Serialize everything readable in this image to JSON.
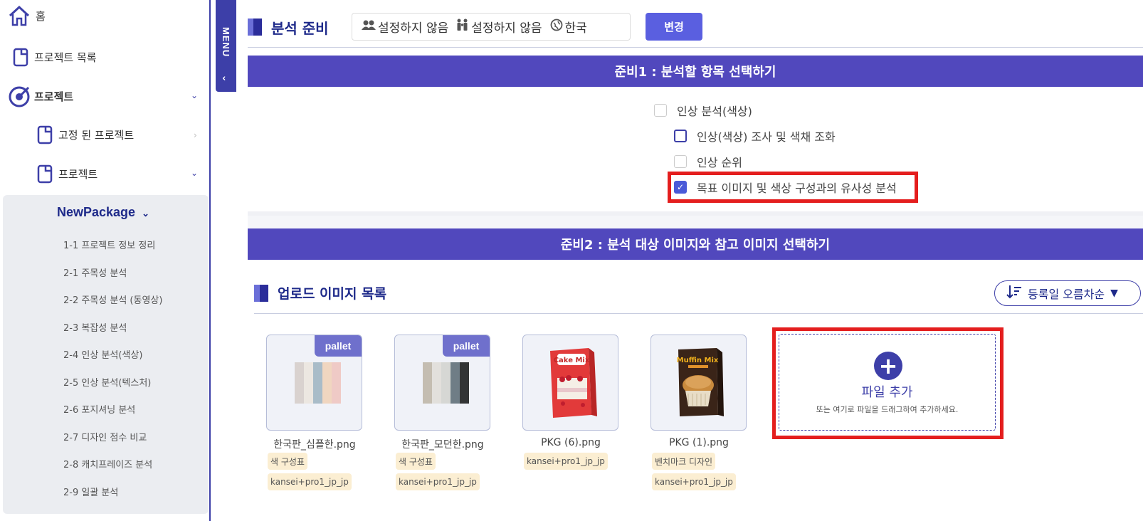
{
  "sidebar": {
    "home": "홈",
    "project_list": "프로젝트 목록",
    "project": "프로젝트",
    "pinned_project": "고정 된 프로젝트",
    "project_sub": "프로젝트",
    "package_name": "NewPackage",
    "package_items": [
      "1-1 프로젝트 정보 정리",
      "2-1 주목성 분석",
      "2-2 주목성 분석 (동영상)",
      "2-3 복잡성 분석",
      "2-4 인상 분석(색상)",
      "2-5 인상 분석(텍스처)",
      "2-6 포지셔닝 분석",
      "2-7 디자인 점수 비교",
      "2-8 캐치프레이즈 분석",
      "2-9 일괄 분석"
    ]
  },
  "menu_tab": {
    "label": "MENU",
    "arrow": "‹"
  },
  "header": {
    "title": "분석 준비",
    "gender": "설정하지 않음",
    "age": "설정하지 않음",
    "region": "한국",
    "change_button": "변경"
  },
  "section1": {
    "title": "준비1 : 분석할 항목 선택하기",
    "options": [
      {
        "label": "인상 분석(색상)",
        "checked": false
      },
      {
        "label": "인상(색상) 조사 및 색채 조화",
        "checked": false
      },
      {
        "label": "인상 순위",
        "checked": false
      },
      {
        "label": "목표 이미지 및 색상 구성과의 유사성 분석",
        "checked": true
      }
    ]
  },
  "section2": {
    "title": "준비2 : 분석 대상 이미지와 참고 이미지 선택하기"
  },
  "upload": {
    "title": "업로드 이미지 목록",
    "sort_label": "등록일 오름차순",
    "files": [
      {
        "name": "한국판_심플한.png",
        "badge": "pallet",
        "tags": [
          "색 구성표",
          "kansei+pro1_jp_jp"
        ],
        "colors": [
          "#d9d2cf",
          "#ece7e1",
          "#a9bcc8",
          "#f0d6c0",
          "#efcac6"
        ]
      },
      {
        "name": "한국판_모던한.png",
        "badge": "pallet",
        "tags": [
          "색 구성표",
          "kansei+pro1_jp_jp"
        ],
        "colors": [
          "#c4bdb1",
          "#e2e0dc",
          "#d6d7d4",
          "#6f7d86",
          "#333535"
        ]
      },
      {
        "name": "PKG (6).png",
        "badge": "",
        "tags": [
          "kansei+pro1_jp_jp"
        ],
        "product": "Cake Mix"
      },
      {
        "name": "PKG (1).png",
        "badge": "",
        "tags": [
          "벤치마크 디자인",
          "kansei+pro1_jp_jp"
        ],
        "product": "Muffin Mix"
      }
    ],
    "add_file_label": "파일 추가",
    "add_file_hint": "또는 여기로 파일을 드래그하여 추가하세요."
  },
  "colors": {
    "accent": "#3d3fa8",
    "section_bar": "#5148bd",
    "highlight": "#e41e1e",
    "tag_bg": "#fbeed2"
  }
}
